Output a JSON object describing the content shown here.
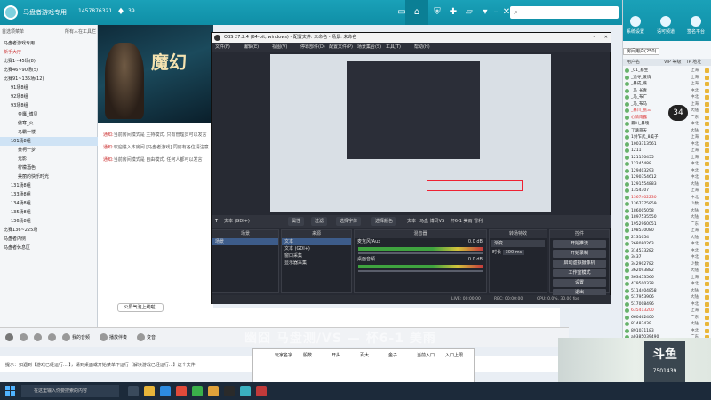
{
  "titlebar": {
    "app_title": "马盘者游戏专用",
    "user_id": "1457876321",
    "coins": "39"
  },
  "leftpanel": {
    "header": "首选项菜单",
    "header2": "所有人在工具栏",
    "items": [
      {
        "label": "马盘者游戏专用",
        "indent": 0
      },
      {
        "label": "新手大厅",
        "indent": 0,
        "hl": true
      },
      {
        "label": "比赛1~45场(8)",
        "indent": 0
      },
      {
        "label": "比赛46~90场(5)",
        "indent": 0
      },
      {
        "label": "比赛91~135场(12)",
        "indent": 0
      },
      {
        "label": "91场8组",
        "indent": 1
      },
      {
        "label": "92场8组",
        "indent": 1
      },
      {
        "label": "93场8组",
        "indent": 1
      },
      {
        "label": "金鹰_博贝",
        "indent": 2
      },
      {
        "label": "傲寒_火",
        "indent": 2
      },
      {
        "label": "马霸一楼",
        "indent": 2
      },
      {
        "label": "101场8组",
        "indent": 1,
        "sel": true
      },
      {
        "label": "黄柯一梦",
        "indent": 2
      },
      {
        "label": "光影",
        "indent": 2
      },
      {
        "label": "柠檬酒色",
        "indent": 2
      },
      {
        "label": "美丽的快乐时光",
        "indent": 2
      },
      {
        "label": "131场8组",
        "indent": 1
      },
      {
        "label": "133场8组",
        "indent": 1
      },
      {
        "label": "134场8组",
        "indent": 1
      },
      {
        "label": "135场8组",
        "indent": 1
      },
      {
        "label": "136场8组",
        "indent": 1
      },
      {
        "label": "比赛136~225场",
        "indent": 0
      },
      {
        "label": "马盘者内侧",
        "indent": 0
      },
      {
        "label": "马盘者休息区",
        "indent": 0
      }
    ]
  },
  "banner": {
    "title": "魔幻"
  },
  "chat": {
    "notices": [
      {
        "tag": "通知:",
        "text": "当前房间模式是 主持模式, 只有管理员可以发言"
      },
      {
        "tag": "通知:",
        "text": "欢迎进入本房间 [马盘者游戏] 同房有各位请注意"
      },
      {
        "tag": "通知:",
        "text": "当前房间模式是 自由模式, 任何人都可以发言"
      }
    ],
    "bubble": "公屏气泡上线啦!"
  },
  "toolbar": {
    "items": [
      "",
      "",
      "",
      "",
      "我的音频",
      "播放伴奏",
      "",
      "变音"
    ]
  },
  "tipbar": {
    "text": "提示：如遇到【游戏已经运行....】，请到桌面或开始菜单下运行【解决游戏已经运行...】这个文件"
  },
  "sheet": {
    "headers": [
      "玩家名字",
      "骰数",
      "开头",
      "百大",
      "金子",
      "当前入口",
      "入口上限"
    ]
  },
  "watermark": "幽囧 马盘测/VS — 杯6-1 美雨",
  "obs": {
    "title": "OBS 27.2.4 (64-bit, windows) - 配置文件: 未命名 - 场景: 未命名",
    "menu": [
      "文件(F)",
      "编辑(E)",
      "视图(V)",
      "停靠部件(D)",
      "配置文件(P)",
      "场景集合(S)",
      "工具(T)",
      "帮助(H)"
    ],
    "strip": {
      "scene_label": "文本 (GDI+)",
      "btn1": "属性",
      "btn2": "过滤",
      "btn3": "选择字体",
      "btn4": "选择颜色",
      "text_label": "文本",
      "text_value": "马盘 博贝VS 一杯6-1 美雨 冒利"
    },
    "docks": {
      "scenes": {
        "title": "场景",
        "items": [
          "场景"
        ]
      },
      "sources": {
        "title": "来源",
        "items": [
          "文本",
          "文本 (GDI+)",
          "窗口采集",
          "显示器采集"
        ]
      },
      "mixer": {
        "title": "混音器",
        "tracks": [
          {
            "name": "麦克风/Aux",
            "db": "0.0 dB"
          },
          {
            "name": "桌面音频",
            "db": "0.0 dB"
          }
        ]
      },
      "transitions": {
        "title": "转场特效",
        "type": "渐变",
        "duration_label": "时长",
        "duration": "300 ms"
      },
      "controls": {
        "title": "控件",
        "buttons": [
          "开始推流",
          "开始录制",
          "启动虚拟摄像机",
          "工作室模式",
          "设置",
          "退出"
        ]
      }
    },
    "status": {
      "live": "LIVE: 00:00:00",
      "rec": "REC: 00:00:00",
      "cpu": "CPU: 0.0%, 30.00 fps"
    }
  },
  "rightpanel": {
    "top_icons": [
      "系统设置",
      "语可频道",
      "签名平台"
    ],
    "tabs": [
      "房间用户(250)",
      "|"
    ],
    "col_headers": [
      "用户名",
      "VIP 等级",
      "IP 地址"
    ],
    "users": [
      {
        "name": "_01_暴生",
        "lv": "",
        "area": "上海"
      },
      {
        "name": "_追寻_爱情",
        "lv": "",
        "area": "上海"
      },
      {
        "name": "_暴成_燕",
        "lv": "",
        "area": "上海"
      },
      {
        "name": "_马_长青",
        "lv": "",
        "area": "中北"
      },
      {
        "name": "_马_布广",
        "lv": "",
        "area": "中北"
      },
      {
        "name": "_马_布马",
        "lv": "",
        "area": "上海"
      },
      {
        "name": "_暴川_张三",
        "lv": "",
        "area": "大陆"
      },
      {
        "name": "心情雨露",
        "lv": "",
        "area": "广东"
      },
      {
        "name": "暴川_暴瑰",
        "lv": "",
        "area": "中北"
      },
      {
        "name": "了滴哥天",
        "lv": "",
        "area": "大陆"
      },
      {
        "name": "1剑乍武_8美子",
        "lv": "",
        "area": "上海"
      },
      {
        "name": "1003313561",
        "lv": "",
        "area": "中北"
      },
      {
        "name": "1211",
        "lv": "",
        "area": "上海"
      },
      {
        "name": "121130455",
        "lv": "",
        "area": "上海"
      },
      {
        "name": "12245488",
        "lv": "",
        "area": "中北"
      },
      {
        "name": "129403293",
        "lv": "",
        "area": "中北"
      },
      {
        "name": "1290354612",
        "lv": "",
        "area": "中北"
      },
      {
        "name": "1291554883",
        "lv": "",
        "area": "大陆"
      },
      {
        "name": "1354307",
        "lv": "",
        "area": "上海"
      },
      {
        "name": "1367402230",
        "lv": "",
        "area": "中北"
      },
      {
        "name": "1367275859",
        "lv": "",
        "area": "少数"
      },
      {
        "name": "186005058",
        "lv": "",
        "area": "大陆"
      },
      {
        "name": "1897535550",
        "lv": "",
        "area": "大陆"
      },
      {
        "name": "1952960051",
        "lv": "",
        "area": "广东"
      },
      {
        "name": "198530080",
        "lv": "",
        "area": "上海"
      },
      {
        "name": "2131054",
        "lv": "",
        "area": "大陆"
      },
      {
        "name": "268080263",
        "lv": "",
        "area": "中北"
      },
      {
        "name": "314533282",
        "lv": "",
        "area": "中北"
      },
      {
        "name": "3437",
        "lv": "",
        "area": "中北"
      },
      {
        "name": "342902782",
        "lv": "",
        "area": "少数"
      },
      {
        "name": "362093882",
        "lv": "",
        "area": "大陆"
      },
      {
        "name": "363453566",
        "lv": "",
        "area": "上海"
      },
      {
        "name": "479500328",
        "lv": "",
        "area": "中北"
      },
      {
        "name": "5114404858",
        "lv": "",
        "area": "大陆"
      },
      {
        "name": "517953906",
        "lv": "",
        "area": "大陆"
      },
      {
        "name": "517008496",
        "lv": "",
        "area": "中北"
      },
      {
        "name": "635413200",
        "lv": "",
        "area": "上海"
      },
      {
        "name": "660462400",
        "lv": "",
        "area": "广东"
      },
      {
        "name": "81483439",
        "lv": "",
        "area": "大陆"
      },
      {
        "name": "891031183",
        "lv": "",
        "area": "中北"
      },
      {
        "name": "a0385039490",
        "lv": "",
        "area": "广东"
      },
      {
        "name": "aa3371723",
        "lv": "",
        "area": "大陆"
      },
      {
        "name": "ab11022384",
        "lv": "",
        "area": "中北"
      },
      {
        "name": "bacca1027",
        "lv": "",
        "area": "少数"
      },
      {
        "name": "cheerFree021",
        "lv": "",
        "area": "上海"
      }
    ],
    "speed": "34"
  },
  "taskbar": {
    "search_placeholder": "在这里输入你要搜索的内容"
  },
  "douyu": {
    "logo": "斗鱼",
    "room": "7501439"
  }
}
